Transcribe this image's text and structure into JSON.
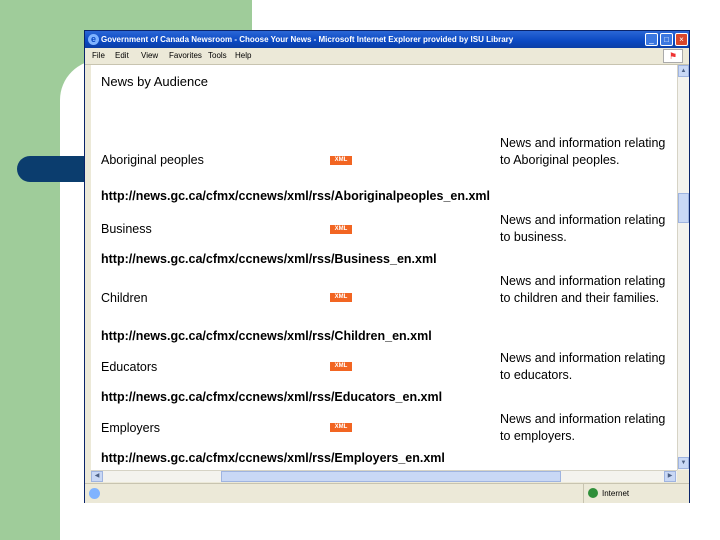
{
  "window": {
    "title": "Government of Canada Newsroom - Choose Your News - Microsoft Internet Explorer provided by ISU Library",
    "buttons": {
      "minimize": "_",
      "maximize": "□",
      "close": "×"
    }
  },
  "menubar": {
    "items": [
      "File",
      "Edit",
      "View",
      "Favorites",
      "Tools",
      "Help"
    ]
  },
  "page": {
    "heading": "News by Audience",
    "badge_label": "XML",
    "feeds": [
      {
        "name": "Aboriginal peoples",
        "description": "News and information relating to Aboriginal peoples.",
        "url": "http://news.gc.ca/cfmx/ccnews/xml/rss/Aboriginalpeoples_en.xml"
      },
      {
        "name": "Business",
        "description": "News and information relating to business.",
        "url": "http://news.gc.ca/cfmx/ccnews/xml/rss/Business_en.xml"
      },
      {
        "name": "Children",
        "description": "News and information relating to children and their families.",
        "url": "http://news.gc.ca/cfmx/ccnews/xml/rss/Children_en.xml"
      },
      {
        "name": "Educators",
        "description": "News and information relating to educators.",
        "url": "http://news.gc.ca/cfmx/ccnews/xml/rss/Educators_en.xml"
      },
      {
        "name": "Employers",
        "description": "News and information relating to employers.",
        "url": "http://news.gc.ca/cfmx/ccnews/xml/rss/Employers_en.xml"
      }
    ]
  },
  "statusbar": {
    "zone": "Internet"
  },
  "colors": {
    "slide_green": "#9fcc9a",
    "slide_blue": "#0b3d6e",
    "xml_badge": "#f26522",
    "titlebar": "#0a48c2"
  }
}
